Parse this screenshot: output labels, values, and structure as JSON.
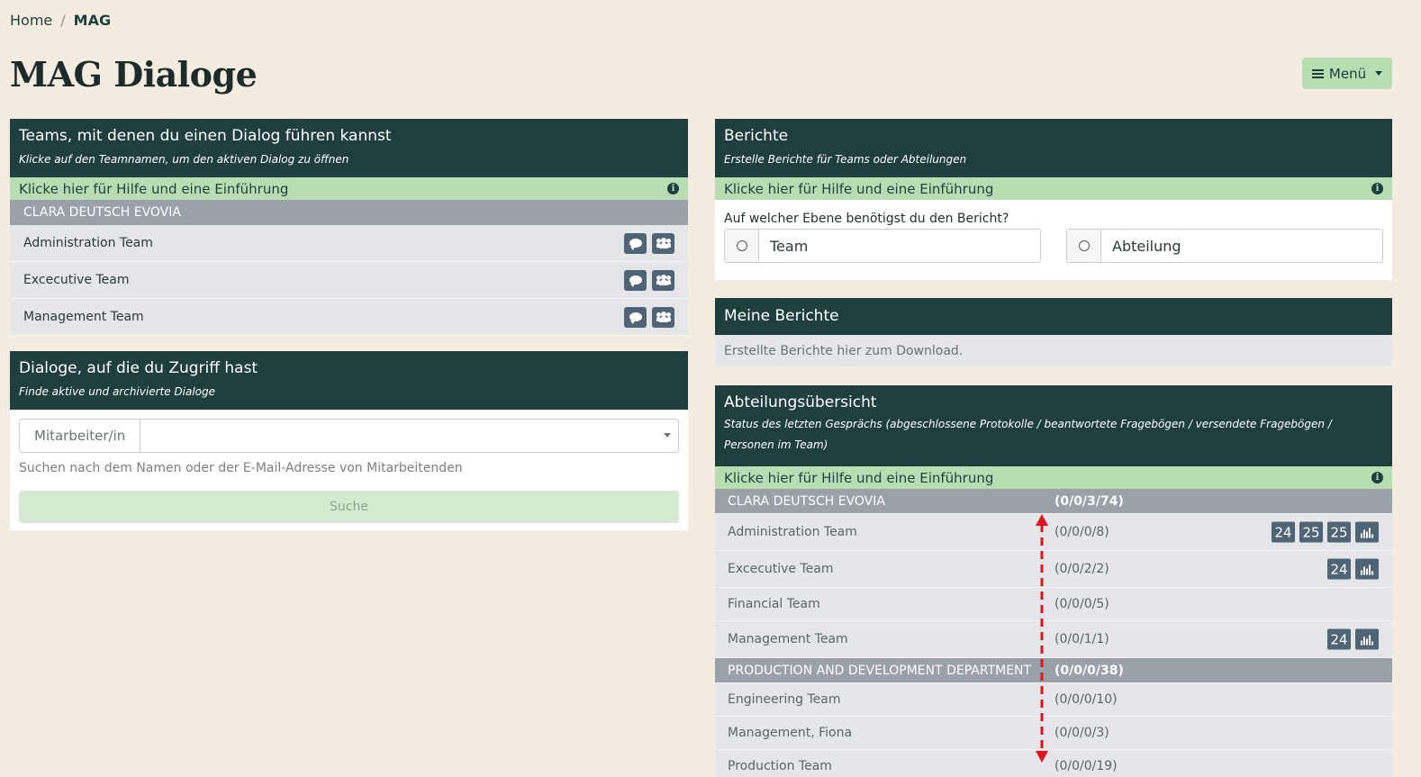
{
  "breadcrumb": {
    "home": "Home",
    "separator": "/",
    "current": "MAG"
  },
  "page_title": "MAG Dialoge",
  "menu": {
    "label": "Menü",
    "icon": "list-icon"
  },
  "teams_card": {
    "title": "Teams, mit denen du einen Dialog führen kannst",
    "subtitle": "Klicke auf den Teamnamen, um den aktiven Dialog zu öffnen",
    "help": "Klicke hier für Hilfe und eine Einführung",
    "group": "CLARA DEUTSCH EVOVIA",
    "teams": [
      {
        "name": "Administration Team"
      },
      {
        "name": "Excecutive Team"
      },
      {
        "name": "Management Team"
      }
    ]
  },
  "dialogs_card": {
    "title": "Dialoge, auf die du Zugriff hast",
    "subtitle": "Finde aktive und archivierte Dialoge",
    "addon": "Mitarbeiter/in",
    "hint": "Suchen nach dem Namen oder der E-Mail-Adresse von Mitarbeitenden",
    "search_label": "Suche"
  },
  "reports_card": {
    "title": "Berichte",
    "subtitle": "Erstelle Berichte für Teams oder Abteilungen",
    "help": "Klicke hier für Hilfe und eine Einführung",
    "question": "Auf welcher Ebene benötigst du den Bericht?",
    "options": [
      "Team",
      "Abteilung"
    ]
  },
  "my_reports_card": {
    "title": "Meine Berichte",
    "text": "Erstellte Berichte hier zum Download."
  },
  "dept_card": {
    "title": "Abteilungsübersicht",
    "subtitle": "Status des letzten Gesprächs (abgeschlossene Protokolle / beantwortete Fragebögen / versendete Fragebögen / Personen im Team)",
    "help": "Klicke hier für Hilfe und eine Einführung",
    "rows": [
      {
        "type": "group",
        "name": "CLARA DEUTSCH EVOVIA",
        "stat": "(0/0/3/74)"
      },
      {
        "type": "team",
        "name": "Administration Team",
        "stat": "(0/0/0/8)",
        "badges": [
          "24",
          "25",
          "25"
        ],
        "chart": true
      },
      {
        "type": "team",
        "name": "Excecutive Team",
        "stat": "(0/0/2/2)",
        "badges": [
          "24"
        ],
        "chart": true
      },
      {
        "type": "team",
        "name": "Financial Team",
        "stat": "(0/0/0/5)",
        "badges": [],
        "chart": false
      },
      {
        "type": "team",
        "name": "Management Team",
        "stat": "(0/0/1/1)",
        "badges": [
          "24"
        ],
        "chart": true
      },
      {
        "type": "group",
        "name": "PRODUCTION AND DEVELOPMENT DEPARTMENT",
        "stat": "(0/0/0/38)"
      },
      {
        "type": "team",
        "name": "Engineering Team",
        "stat": "(0/0/0/10)",
        "badges": [],
        "chart": false
      },
      {
        "type": "team",
        "name": "Management, Fiona",
        "stat": "(0/0/0/3)",
        "badges": [],
        "chart": false
      },
      {
        "type": "team",
        "name": "Production Team",
        "stat": "(0/0/0/19)",
        "badges": [],
        "chart": false
      }
    ]
  },
  "colors": {
    "background": "#f5ece1",
    "header": "#1f3f3e",
    "help_bar": "#b9ddb3",
    "group_row": "#9aa1a9",
    "row": "#e4e6ea",
    "badge": "#4f6475",
    "arrow": "#e0141e"
  }
}
